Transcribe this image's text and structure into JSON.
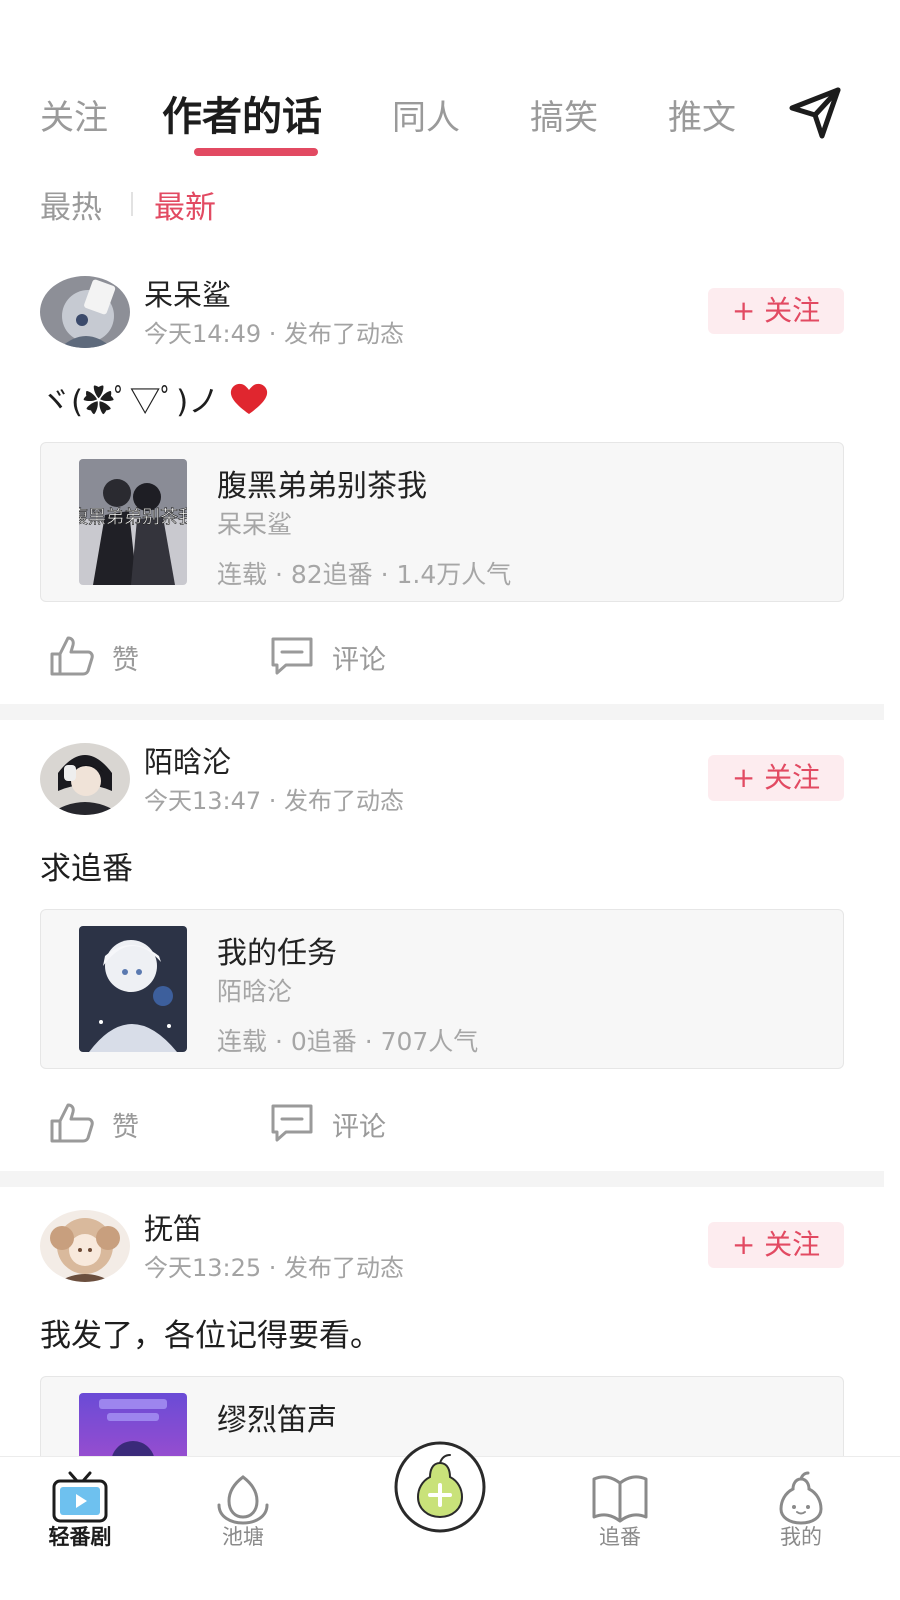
{
  "top_tabs": {
    "tabs": [
      {
        "label": "关注"
      },
      {
        "label": "作者的话"
      },
      {
        "label": "同人"
      },
      {
        "label": "搞笑"
      },
      {
        "label": "推文"
      }
    ],
    "active_index": 1,
    "send_icon": "paper-plane-icon"
  },
  "sort": {
    "items": [
      {
        "label": "最热"
      },
      {
        "label": "最新"
      }
    ],
    "active_index": 1
  },
  "colors": {
    "accent": "#e24a62",
    "follow_bg": "#fdecef",
    "card_bg": "#f7f7f7",
    "separator": "#f4f4f4",
    "pear_green": "#c9e27a"
  },
  "posts": [
    {
      "author": "呆呆鲨",
      "meta": "今天14:49 · 发布了动态",
      "follow_label": "+ 关注",
      "text": "ヾ(✿ﾟ▽ﾟ)ノ",
      "has_heart": true,
      "work": {
        "title": "腹黑弟弟别茶我",
        "author": "呆呆鲨",
        "stats": "连载 · 82追番 · 1.4万人气",
        "cover_text": "腹黑弟弟别茶我"
      },
      "like_label": "赞",
      "comment_label": "评论"
    },
    {
      "author": "陌晗沦",
      "meta": "今天13:47 · 发布了动态",
      "follow_label": "+ 关注",
      "text": "求追番",
      "has_heart": false,
      "work": {
        "title": "我的任务",
        "author": "陌晗沦",
        "stats": "连载 · 0追番 · 707人气"
      },
      "like_label": "赞",
      "comment_label": "评论"
    },
    {
      "author": "抚笛",
      "meta": "今天13:25 · 发布了动态",
      "follow_label": "+ 关注",
      "text": "我发了，各位记得要看。",
      "has_heart": false,
      "work": {
        "title": "缪烈笛声"
      }
    }
  ],
  "bottom_nav": {
    "items": [
      {
        "label": "轻番剧",
        "icon": "tv-icon"
      },
      {
        "label": "池塘",
        "icon": "pond-icon"
      },
      {
        "label": "",
        "icon": "pear-add-icon"
      },
      {
        "label": "追番",
        "icon": "book-icon"
      },
      {
        "label": "我的",
        "icon": "pear-face-icon"
      }
    ],
    "active_index": 0
  }
}
